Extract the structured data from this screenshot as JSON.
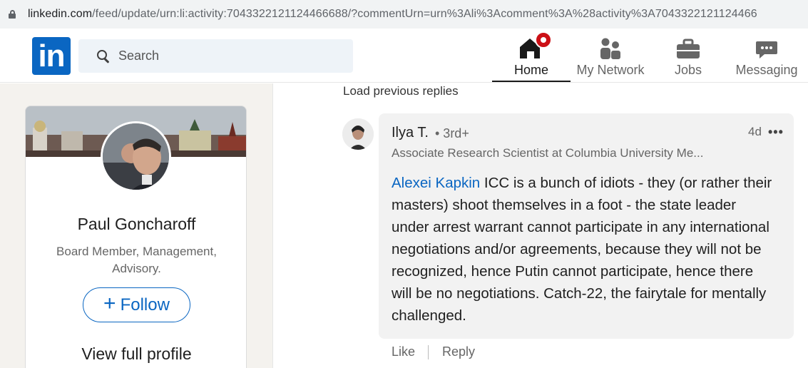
{
  "browser": {
    "url_main": "linkedin.com",
    "url_rest": "/feed/update/urn:li:activity:7043322121124466688/?commentUrn=urn%3Ali%3Acomment%3A%28activity%3A7043322121124466"
  },
  "nav": {
    "logo_text": "in",
    "search_placeholder": "Search",
    "items": [
      {
        "label": "Home",
        "icon": "home-icon",
        "active": true
      },
      {
        "label": "My Network",
        "icon": "people-icon"
      },
      {
        "label": "Jobs",
        "icon": "briefcase-icon"
      },
      {
        "label": "Messaging",
        "icon": "chat-icon"
      }
    ]
  },
  "profile_card": {
    "name": "Paul Goncharoff",
    "headline": "Board Member, Management, Advisory.",
    "follow_label": "Follow",
    "view_profile_label": "View full profile"
  },
  "comments": {
    "load_previous_label": "Load previous replies",
    "comment": {
      "author": "Ilya T.",
      "degree": "• 3rd+",
      "title": "Associate Research Scientist at Columbia University Me...",
      "time": "4d",
      "more": "•••",
      "mention": "Alexei Kapkin",
      "text": " ICC is a bunch of idiots - they (or rather their masters) shoot themselves in a foot - the state leader under arrest warrant cannot participate in any international negotiations and/or agreements, because they will not be recognized, hence Putin cannot participate, hence there will be no negotiations. Catch-22, the fairytale for mentally challenged.",
      "like_label": "Like",
      "reply_label": "Reply"
    }
  },
  "colors": {
    "brand": "#0a66c2",
    "badge": "#cc1016"
  }
}
